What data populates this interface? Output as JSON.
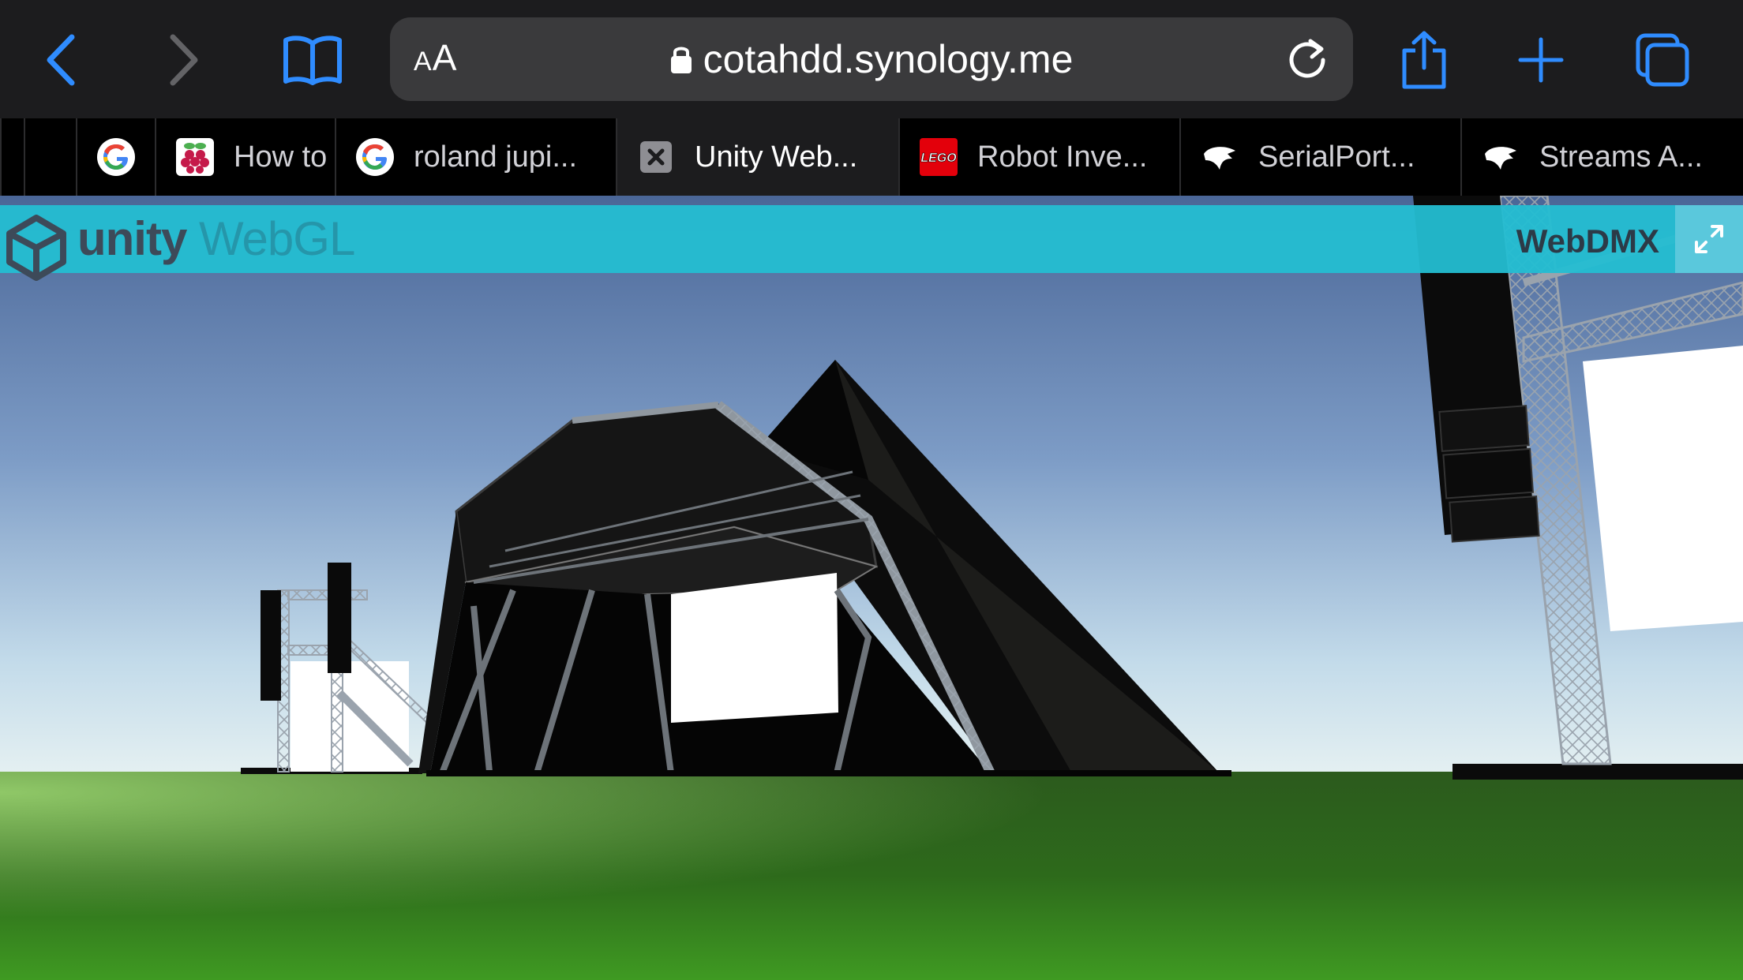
{
  "toolbar": {
    "aa_small": "A",
    "aa_large": "A",
    "url": "cotahdd.synology.me",
    "icons": [
      "back-icon",
      "forward-icon",
      "bookmarks-icon",
      "lock-icon",
      "reload-icon",
      "share-icon",
      "new-tab-icon",
      "tabs-overview-icon"
    ]
  },
  "tabs": [
    {
      "title": "",
      "favicon": "pinned-icon"
    },
    {
      "title": "",
      "favicon": "google-icon"
    },
    {
      "title": "How to",
      "favicon": "raspberry-pi-icon"
    },
    {
      "title": "roland jupi...",
      "favicon": "google-icon"
    },
    {
      "title": "Unity Web...",
      "favicon": "close-tab-icon",
      "active": true
    },
    {
      "title": "Robot Inve...",
      "favicon": "lego-icon"
    },
    {
      "title": "SerialPort...",
      "favicon": "bird-icon"
    },
    {
      "title": "Streams A...",
      "favicon": "bird-icon"
    }
  ],
  "unity_bar": {
    "brand": "unity",
    "product": "WebGL",
    "app_title": "WebDMX"
  },
  "colors": {
    "toolbar_bg": "#1c1c1e",
    "accent_blue": "#2f8cff",
    "unity_bar": "#24bed2",
    "sky_top": "#4d6a9c",
    "sky_bottom": "#cfe3ef",
    "grass": "#2e6e1c"
  },
  "lego_text": "LEGO"
}
